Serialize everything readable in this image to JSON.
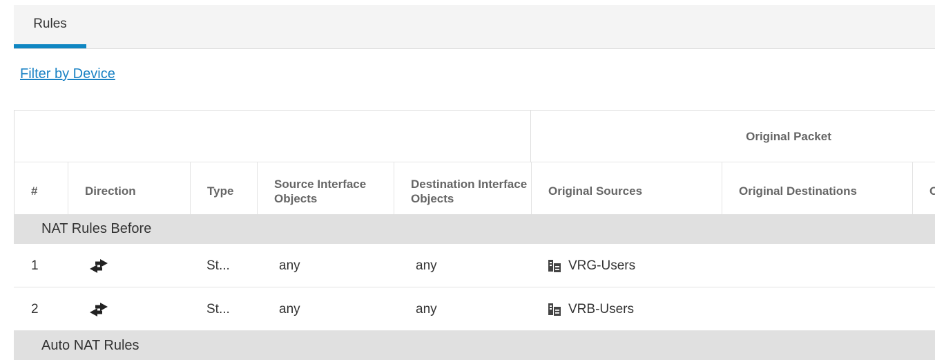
{
  "tabs": [
    {
      "label": "Rules",
      "active": true
    }
  ],
  "filter_link": "Filter by Device",
  "table": {
    "group_header": "Original Packet",
    "columns": [
      {
        "key": "num",
        "label": "#"
      },
      {
        "key": "direction",
        "label": "Direction"
      },
      {
        "key": "type",
        "label": "Type"
      },
      {
        "key": "src_if",
        "label": "Source Interface Objects"
      },
      {
        "key": "dst_if",
        "label": "Destination Interface Objects"
      },
      {
        "key": "orig_src",
        "label": "Original Sources"
      },
      {
        "key": "orig_dst",
        "label": "Original Destinations"
      },
      {
        "key": "orig_svc",
        "label": "Original Services"
      }
    ],
    "sections": [
      {
        "label": "NAT Rules Before",
        "rows": [
          {
            "num": "1",
            "direction": "bidirectional-arrows-icon",
            "type": "St...",
            "src_if": "any",
            "dst_if": "any",
            "orig_src": "VRG-Users"
          },
          {
            "num": "2",
            "direction": "bidirectional-arrows-icon",
            "type": "St...",
            "src_if": "any",
            "dst_if": "any",
            "orig_src": "VRB-Users"
          }
        ]
      },
      {
        "label": "Auto NAT Rules",
        "rows": []
      }
    ]
  },
  "icons": {
    "direction": "bidirectional-arrows-icon",
    "object": "network-group-icon"
  },
  "colors": {
    "accent": "#0f86c2",
    "link": "#1a82c4",
    "section_bg": "#e0e0e0"
  }
}
